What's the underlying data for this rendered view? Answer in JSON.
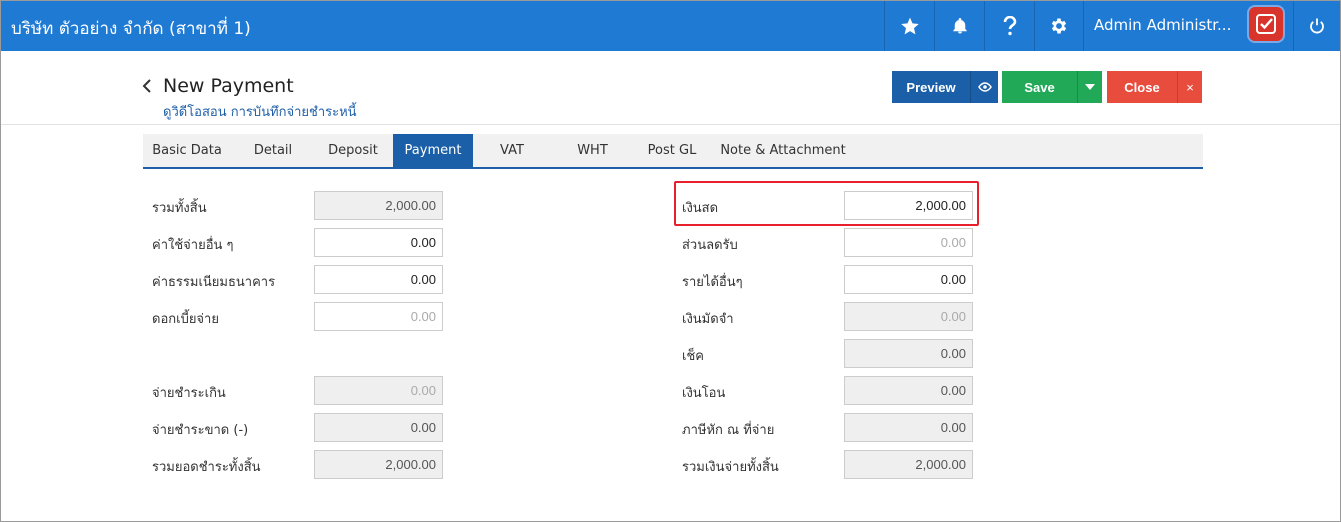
{
  "topbar": {
    "company": "บริษัท ตัวอย่าง จำกัด (สาขาที่ 1)",
    "user_name": "Admin Administr...",
    "icons": [
      "star-icon",
      "bell-icon",
      "help-icon",
      "gear-icon",
      "power-icon"
    ]
  },
  "header": {
    "back": "<",
    "title": "New Payment",
    "subtitle": "ดูวิดีโอสอน การบันทึกจ่ายชำระหนี้",
    "preview_label": "Preview",
    "save_label": "Save",
    "close_label": "Close",
    "close_x": "×"
  },
  "tabs": [
    {
      "label": "Basic Data"
    },
    {
      "label": "Detail"
    },
    {
      "label": "Deposit"
    },
    {
      "label": "Payment",
      "active": true
    },
    {
      "label": "VAT"
    },
    {
      "label": "WHT"
    },
    {
      "label": "Post GL"
    },
    {
      "label": "Note & Attachment"
    }
  ],
  "left_fields": [
    {
      "label": "รวมทั้งสิ้น",
      "value": "2,000.00"
    },
    {
      "label": "ค่าใช้จ่ายอื่น ๆ",
      "value": "0.00"
    },
    {
      "label": "ค่าธรรมเนียมธนาคาร",
      "value": "0.00"
    },
    {
      "label": "ดอกเบี้ยจ่าย",
      "value": "0.00"
    },
    {
      "label": "จ่ายชำระเกิน",
      "value": "0.00"
    },
    {
      "label": "จ่ายชำระขาด (-)",
      "value": "0.00"
    },
    {
      "label": "รวมยอดชำระทั้งสิ้น",
      "value": "2,000.00"
    }
  ],
  "right_fields": [
    {
      "label": "เงินสด",
      "value": "2,000.00"
    },
    {
      "label": "ส่วนลดรับ",
      "value": "0.00"
    },
    {
      "label": "รายได้อื่นๆ",
      "value": "0.00"
    },
    {
      "label": "เงินมัดจำ",
      "value": "0.00"
    },
    {
      "label": "เช็ค",
      "value": "0.00"
    },
    {
      "label": "เงินโอน",
      "value": "0.00"
    },
    {
      "label": "ภาษีหัก ณ ที่จ่าย",
      "value": "0.00"
    },
    {
      "label": "รวมเงินจ่ายทั้งสิ้น",
      "value": "2,000.00"
    }
  ]
}
